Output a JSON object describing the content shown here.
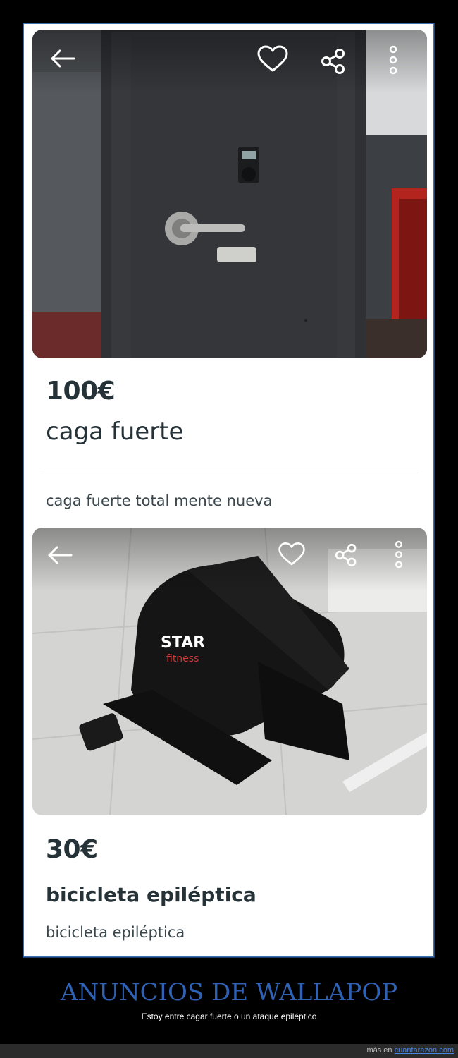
{
  "listings": [
    {
      "price": "100€",
      "title": "caga fuerte",
      "description": "caga fuerte total mente nueva"
    },
    {
      "price": "30€",
      "title": "bicicleta epiléptica",
      "description": "bicicleta epiléptica",
      "photo_logo": "STAR",
      "photo_logo_sub": "fitness"
    }
  ],
  "icons": [
    "back-arrow-icon",
    "heart-icon",
    "share-icon",
    "more-vertical-icon"
  ],
  "caption": {
    "title": "ANUNCIOS DE WALLAPOP",
    "subtitle": "Estoy entre cagar fuerte o un ataque epiléptico"
  },
  "footer": {
    "prefix": "más en",
    "link": "cuantarazon.com"
  },
  "colors": {
    "background": "#000000",
    "caption_title": "#2f62b4",
    "text_dark": "#253238"
  }
}
